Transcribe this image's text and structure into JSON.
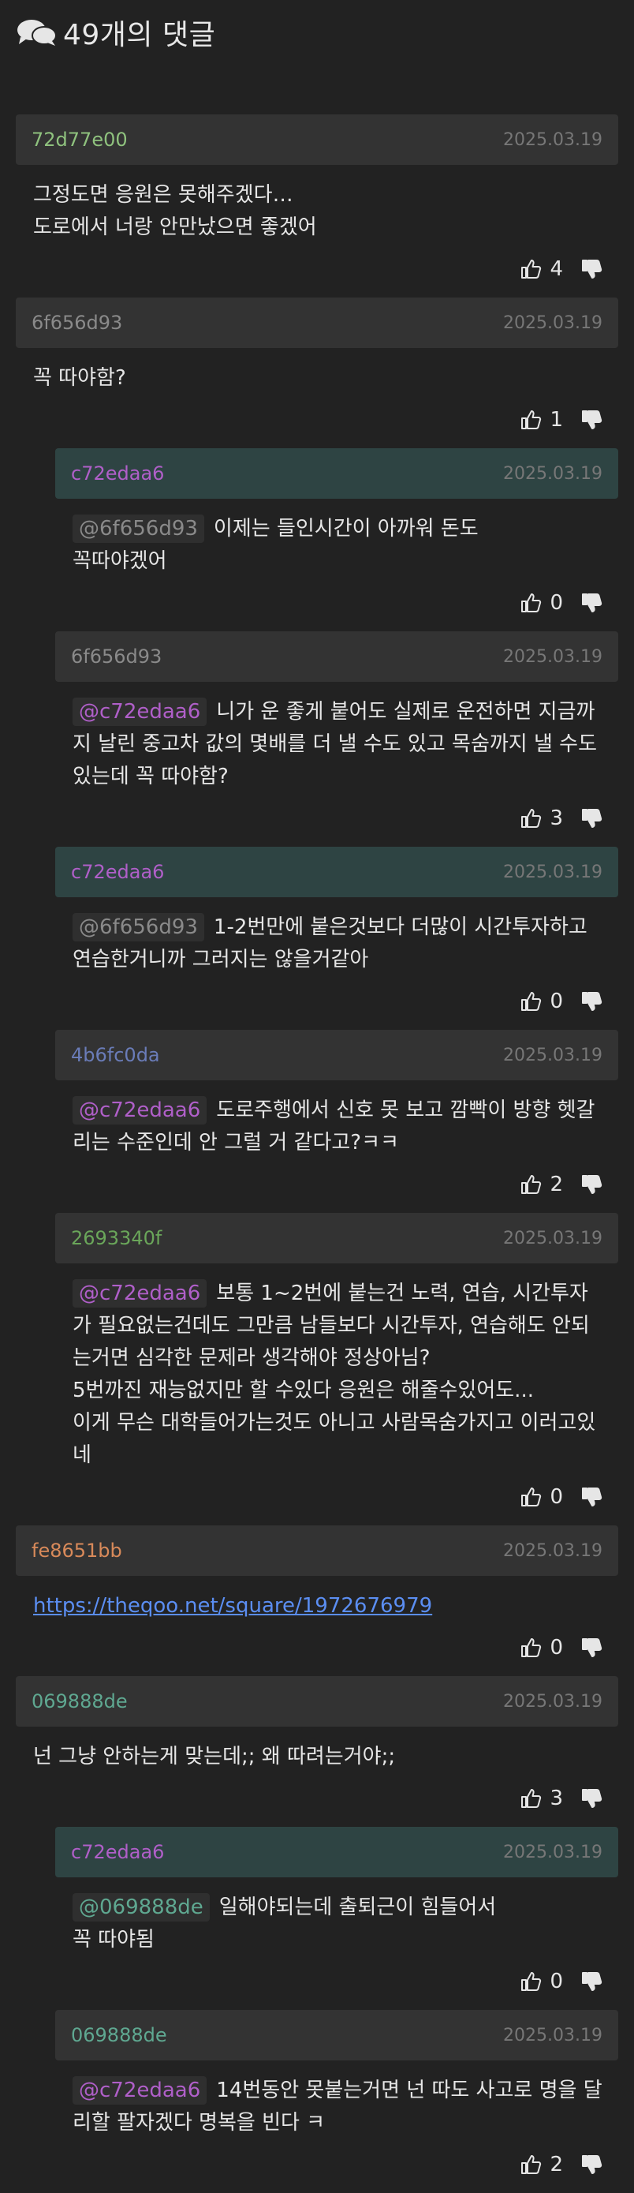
{
  "header": {
    "icon": "comments-icon",
    "title": "49개의 댓글"
  },
  "comments": [
    {
      "id": "72d77e00",
      "idColor": "#8fc27e",
      "date": "2025.03.19",
      "op": false,
      "reply": false,
      "mention": "",
      "mentionColor": "",
      "text": "그정도면 응원은 못해주겠다…\n도로에서 너랑 안만났으면 좋겠어",
      "link": "",
      "likes": "4"
    },
    {
      "id": "6f656d93",
      "idColor": "#8a8a8a",
      "date": "2025.03.19",
      "op": false,
      "reply": false,
      "mention": "",
      "mentionColor": "",
      "text": "꼭 따야함?",
      "link": "",
      "likes": "1"
    },
    {
      "id": "c72edaa6",
      "idColor": "#b05fc9",
      "date": "2025.03.19",
      "op": true,
      "reply": true,
      "mention": "@6f656d93",
      "mentionColor": "#8a8a8a",
      "text": "이제는 들인시간이 아까워 돈도\n꼭따야겠어",
      "link": "",
      "likes": "0"
    },
    {
      "id": "6f656d93",
      "idColor": "#8a8a8a",
      "date": "2025.03.19",
      "op": false,
      "reply": true,
      "mention": "@c72edaa6",
      "mentionColor": "#b05fc9",
      "text": "니가 운 좋게 붙어도 실제로 운전하면 지금까지 날린 중고차 값의 몇배를 더 낼 수도 있고 목숨까지 낼 수도 있는데 꼭 따야함?",
      "link": "",
      "likes": "3"
    },
    {
      "id": "c72edaa6",
      "idColor": "#b05fc9",
      "date": "2025.03.19",
      "op": true,
      "reply": true,
      "mention": "@6f656d93",
      "mentionColor": "#8a8a8a",
      "text": "1-2번만에 붙은것보다 더많이 시간투자하고 연습한거니까 그러지는 않을거같아",
      "link": "",
      "likes": "0"
    },
    {
      "id": "4b6fc0da",
      "idColor": "#6a7cb8",
      "date": "2025.03.19",
      "op": false,
      "reply": true,
      "mention": "@c72edaa6",
      "mentionColor": "#b05fc9",
      "text": "도로주행에서 신호 못 보고 깜빡이 방향 헷갈리는 수준인데 안 그럴 거 같다고?ㅋㅋ",
      "link": "",
      "likes": "2"
    },
    {
      "id": "2693340f",
      "idColor": "#6aa65a",
      "date": "2025.03.19",
      "op": false,
      "reply": true,
      "mention": "@c72edaa6",
      "mentionColor": "#b05fc9",
      "text": "보통 1~2번에 붙는건 노력, 연습, 시간투자가 필요없는건데도 그만큼 남들보다 시간투자, 연습해도 안되는거면 심각한 문제라 생각해야 정상아님?\n5번까진 재능없지만 할 수있다 응원은 해줄수있어도...\n이게 무슨 대학들어가는것도 아니고 사람목숨가지고 이러고있네",
      "link": "",
      "likes": "0"
    },
    {
      "id": "fe8651bb",
      "idColor": "#d98a5a",
      "date": "2025.03.19",
      "op": false,
      "reply": false,
      "mention": "",
      "mentionColor": "",
      "text": "",
      "link": "https://theqoo.net/square/1972676979",
      "likes": "0"
    },
    {
      "id": "069888de",
      "idColor": "#5fa891",
      "date": "2025.03.19",
      "op": false,
      "reply": false,
      "mention": "",
      "mentionColor": "",
      "text": "넌 그냥 안하는게 맞는데;; 왜 따려는거야;;",
      "link": "",
      "likes": "3"
    },
    {
      "id": "c72edaa6",
      "idColor": "#b05fc9",
      "date": "2025.03.19",
      "op": true,
      "reply": true,
      "mention": "@069888de",
      "mentionColor": "#5fa891",
      "text": "일해야되는데 출퇴근이 힘들어서\n꼭 따야됨",
      "link": "",
      "likes": "0"
    },
    {
      "id": "069888de",
      "idColor": "#5fa891",
      "date": "2025.03.19",
      "op": false,
      "reply": true,
      "mention": "@c72edaa6",
      "mentionColor": "#b05fc9",
      "text": "14번동안 못붙는거면 넌 따도 사고로 명을 달리할 팔자겠다 명복을 빈다 ㅋ",
      "link": "",
      "likes": "2"
    }
  ]
}
